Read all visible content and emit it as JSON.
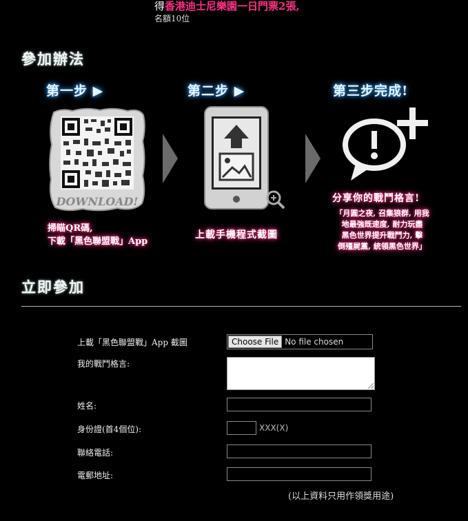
{
  "intro": {
    "prefix": "得",
    "prize": "香港迪士尼樂園一日門票2張,",
    "quota": "名額10位"
  },
  "how_to": {
    "title": "參加辦法",
    "steps": [
      {
        "title": "第一步 ▶",
        "image_label": "DOWNLOAD!",
        "caption_line1": "掃瞄QR碼,",
        "caption_line2": "下載「黑色聯盟戰」App",
        "icon": "qr-code-icon"
      },
      {
        "title": "第二步 ▶",
        "caption_line1": "上載手機程式截圖",
        "icon": "phone-upload-icon"
      },
      {
        "title": "第三步完成!",
        "headline": "分享你的戰鬥格言!",
        "quote_lines": [
          "「月圓之夜, 召集狼群, 用我",
          "地最強既速度, 耐力玩盡",
          "黑色世界提升戰鬥力, 擊",
          "倒殭屍黨, 統領黑色世界」"
        ],
        "icon": "speech-bubble-plus-icon"
      }
    ]
  },
  "join": {
    "title": "立即參加",
    "fields": {
      "upload_label": "上載「黑色聯盟戰」App 截圖",
      "file_button": "Choose File",
      "file_status": "No file chosen",
      "motto_label": "我的戰鬥格言:",
      "name_label": "姓名:",
      "id_label": "身份證(首4個位):",
      "id_hint": "XXX(X)",
      "phone_label": "聯絡電話:",
      "email_label": "電郵地址:"
    },
    "note": "(以上資料只用作領獎用途)"
  }
}
